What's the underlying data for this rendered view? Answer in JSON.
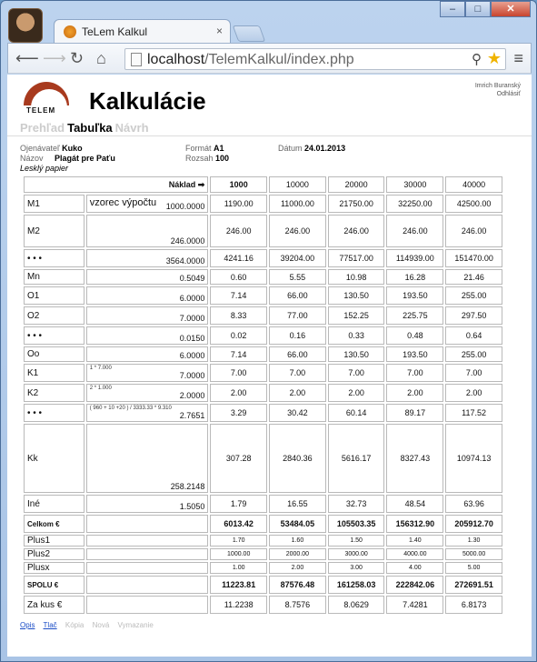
{
  "browser": {
    "tab_title": "TeLem Kalkul",
    "tab_close": "×",
    "url_host": "localhost",
    "url_path": "/TelemKalkul/index.php",
    "btn_min": "–",
    "btn_max": "□",
    "btn_close": "✕"
  },
  "header": {
    "logo_text": "TELEM",
    "title": "Kalkulácie",
    "user_name": "Imrich Buranský",
    "logout": "Odhlásiť"
  },
  "nav": {
    "tabs": [
      {
        "label": "Prehľad"
      },
      {
        "label": "Tabuľka"
      },
      {
        "label": "Návrh"
      }
    ]
  },
  "meta": {
    "objednavatel_label": "Ojenávateľ",
    "objednavatel_value": "Kuko",
    "nazov_label": "Názov",
    "nazov_value": "Plagát pre Paťu",
    "papier": "Lesklý papier",
    "format_label": "Formát",
    "format_value": "A1",
    "rozsah_label": "Rozsah",
    "rozsah_value": "100",
    "datum_label": "Dátum",
    "datum_value": "24.01.2013"
  },
  "table": {
    "naklad_label": "Náklad ➡",
    "quantities": [
      "1000",
      "10000",
      "20000",
      "30000",
      "40000"
    ],
    "rows": [
      {
        "label": "M1",
        "formula_text": "vzorec výpočtu",
        "formula_small": "",
        "formula_value": "1000.0000",
        "values": [
          "1190.00",
          "11000.00",
          "21750.00",
          "32250.00",
          "42500.00"
        ]
      },
      {
        "label": "M2",
        "formula_text": "",
        "formula_small": "",
        "formula_value": "246.0000",
        "values": [
          "246.00",
          "246.00",
          "246.00",
          "246.00",
          "246.00"
        ]
      },
      {
        "label": "• • •",
        "formula_text": "",
        "formula_small": "",
        "formula_value": "3564.0000",
        "values": [
          "4241.16",
          "39204.00",
          "77517.00",
          "114939.00",
          "151470.00"
        ]
      },
      {
        "label": "Mn",
        "formula_text": "",
        "formula_small": "",
        "formula_value": "0.5049",
        "values": [
          "0.60",
          "5.55",
          "10.98",
          "16.28",
          "21.46"
        ]
      },
      {
        "label": "O1",
        "formula_text": "",
        "formula_small": "",
        "formula_value": "6.0000",
        "values": [
          "7.14",
          "66.00",
          "130.50",
          "193.50",
          "255.00"
        ]
      },
      {
        "label": "O2",
        "formula_text": "",
        "formula_small": "",
        "formula_value": "7.0000",
        "values": [
          "8.33",
          "77.00",
          "152.25",
          "225.75",
          "297.50"
        ]
      },
      {
        "label": "• • •",
        "formula_text": "",
        "formula_small": "",
        "formula_value": "0.0150",
        "values": [
          "0.02",
          "0.16",
          "0.33",
          "0.48",
          "0.64"
        ]
      },
      {
        "label": "Oo",
        "formula_text": "",
        "formula_small": "",
        "formula_value": "6.0000",
        "values": [
          "7.14",
          "66.00",
          "130.50",
          "193.50",
          "255.00"
        ]
      },
      {
        "label": "K1",
        "formula_text": "",
        "formula_small": "1 * 7.000",
        "formula_value": "7.0000",
        "values": [
          "7.00",
          "7.00",
          "7.00",
          "7.00",
          "7.00"
        ]
      },
      {
        "label": "K2",
        "formula_text": "",
        "formula_small": "2 * 1.000",
        "formula_value": "2.0000",
        "values": [
          "2.00",
          "2.00",
          "2.00",
          "2.00",
          "2.00"
        ]
      },
      {
        "label": "• • •",
        "formula_text": "",
        "formula_small": "( 960 + 10 +20 ) / 3333.33 * 9.310",
        "formula_value": "2.7651",
        "values": [
          "3.29",
          "30.42",
          "60.14",
          "89.17",
          "117.52"
        ]
      },
      {
        "label": "Kk",
        "formula_text": "",
        "formula_small": "",
        "formula_value": "258.2148",
        "values": [
          "307.28",
          "2840.36",
          "5616.17",
          "8327.43",
          "10974.13"
        ]
      },
      {
        "label": "Iné",
        "formula_text": "",
        "formula_small": "",
        "formula_value": "1.5050",
        "values": [
          "1.79",
          "16.55",
          "32.73",
          "48.54",
          "63.96"
        ]
      }
    ],
    "celkom": {
      "label": "Celkom €",
      "values": [
        "6013.42",
        "53484.05",
        "105503.35",
        "156312.90",
        "205912.70"
      ]
    },
    "plus": [
      {
        "label": "Plus1",
        "values": [
          "1.70",
          "1.60",
          "1.50",
          "1.40",
          "1.30"
        ]
      },
      {
        "label": "Plus2",
        "values": [
          "1000.00",
          "2000.00",
          "3000.00",
          "4000.00",
          "5000.00"
        ]
      },
      {
        "label": "Plusx",
        "values": [
          "1.00",
          "2.00",
          "3.00",
          "4.00",
          "5.00"
        ]
      }
    ],
    "spolu": {
      "label": "SPOLU €",
      "values": [
        "11223.81",
        "87576.48",
        "161258.03",
        "222842.06",
        "272691.51"
      ]
    },
    "zakus": {
      "label": "Za kus €",
      "values": [
        "11.2238",
        "8.7576",
        "8.0629",
        "7.4281",
        "6.8173"
      ]
    }
  },
  "footer": {
    "links": [
      {
        "label": "Opis",
        "enabled": true
      },
      {
        "label": "Tlač",
        "enabled": true
      },
      {
        "label": "Kópia",
        "enabled": false
      },
      {
        "label": "Nová",
        "enabled": false
      },
      {
        "label": "Vymazanie",
        "enabled": false
      }
    ]
  }
}
